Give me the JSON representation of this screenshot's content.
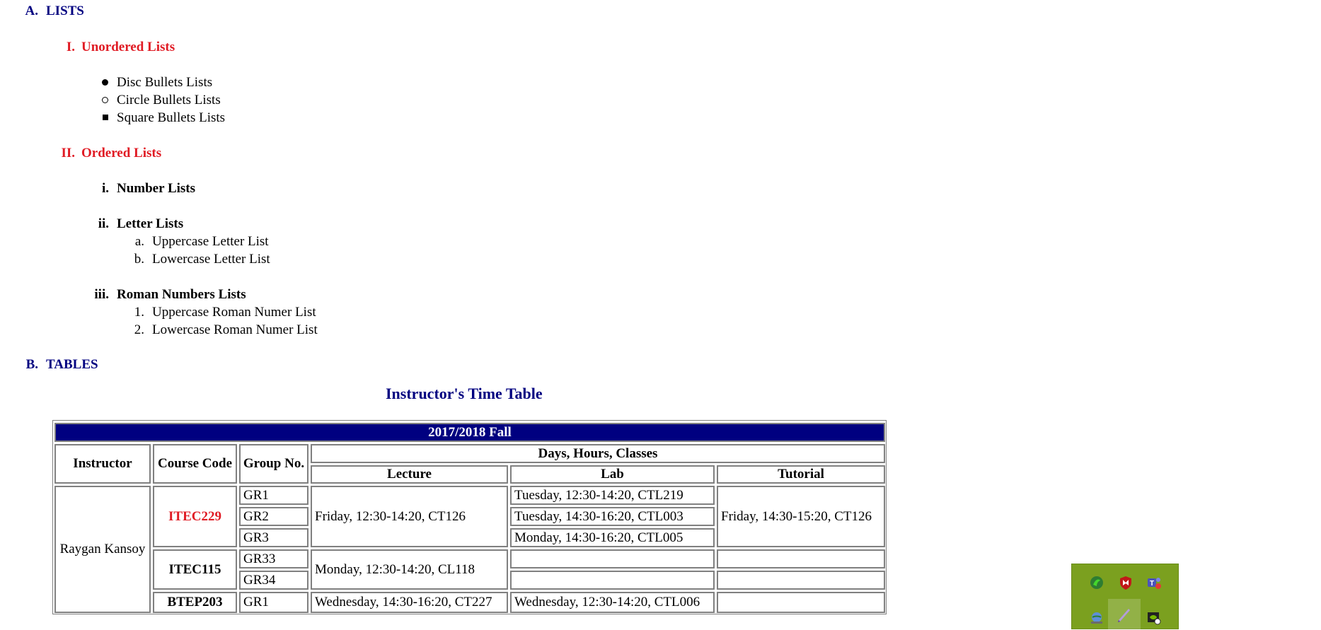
{
  "lists_section": {
    "marker": "A.",
    "title": "LISTS",
    "unordered": {
      "marker": "I.",
      "title": "Unordered Lists",
      "items": [
        "Disc Bullets Lists",
        "Circle Bullets Lists",
        "Square Bullets Lists"
      ]
    },
    "ordered": {
      "marker": "II.",
      "title": "Ordered Lists",
      "number_lists": {
        "marker": "i.",
        "title": "Number Lists"
      },
      "letter_lists": {
        "marker": "ii.",
        "title": "Letter Lists",
        "items": [
          {
            "marker": "a.",
            "label": "Uppercase Letter List"
          },
          {
            "marker": "b.",
            "label": "Lowercase Letter List"
          }
        ]
      },
      "roman_lists": {
        "marker": "iii.",
        "title": "Roman Numbers Lists",
        "items": [
          {
            "marker": "1.",
            "label": "Uppercase Roman Numer List"
          },
          {
            "marker": "2.",
            "label": "Lowercase Roman Numer List"
          }
        ]
      }
    }
  },
  "tables_section": {
    "marker": "B.",
    "title": "TABLES",
    "caption": "Instructor's Time Table",
    "table": {
      "title": "2017/2018 Fall",
      "headers": {
        "instructor": "Instructor",
        "course_code": "Course Code",
        "group_no": "Group No.",
        "days_hours_classes": "Days, Hours, Classes",
        "lecture": "Lecture",
        "lab": "Lab",
        "tutorial": "Tutorial"
      },
      "instructor": "Raygan Kansoy",
      "courses": [
        {
          "code": "ITEC229",
          "groups": [
            "GR1",
            "GR2",
            "GR3"
          ],
          "lecture": "Friday, 12:30-14:20, CT126",
          "labs": [
            "Tuesday, 12:30-14:20, CTL219",
            "Tuesday, 14:30-16:20, CTL003",
            "Monday, 14:30-16:20, CTL005"
          ],
          "tutorial": "Friday, 14:30-15:20, CT126"
        },
        {
          "code": "ITEC115",
          "groups": [
            "GR33",
            "GR34"
          ],
          "lecture": "Monday, 12:30-14:20, CL118",
          "labs": [
            "",
            ""
          ],
          "tutorial": ""
        },
        {
          "code": "BTEP203",
          "groups": [
            "GR1"
          ],
          "lecture": "Wednesday, 14:30-16:20, CT227",
          "labs": [
            "Wednesday, 12:30-14:20, CTL006"
          ],
          "tutorial": ""
        }
      ]
    }
  },
  "system_tray": {
    "background": "#7ba01f",
    "icons": [
      "razer-icon",
      "mcafee-icon",
      "teams-icon",
      "network-globe-icon",
      "pen-icon",
      "nvidia-icon"
    ]
  },
  "colors": {
    "section_heading": "#000080",
    "subsection_heading": "#e01b24",
    "table_title_bg": "#000080",
    "course_code_red": "#e01b24"
  }
}
